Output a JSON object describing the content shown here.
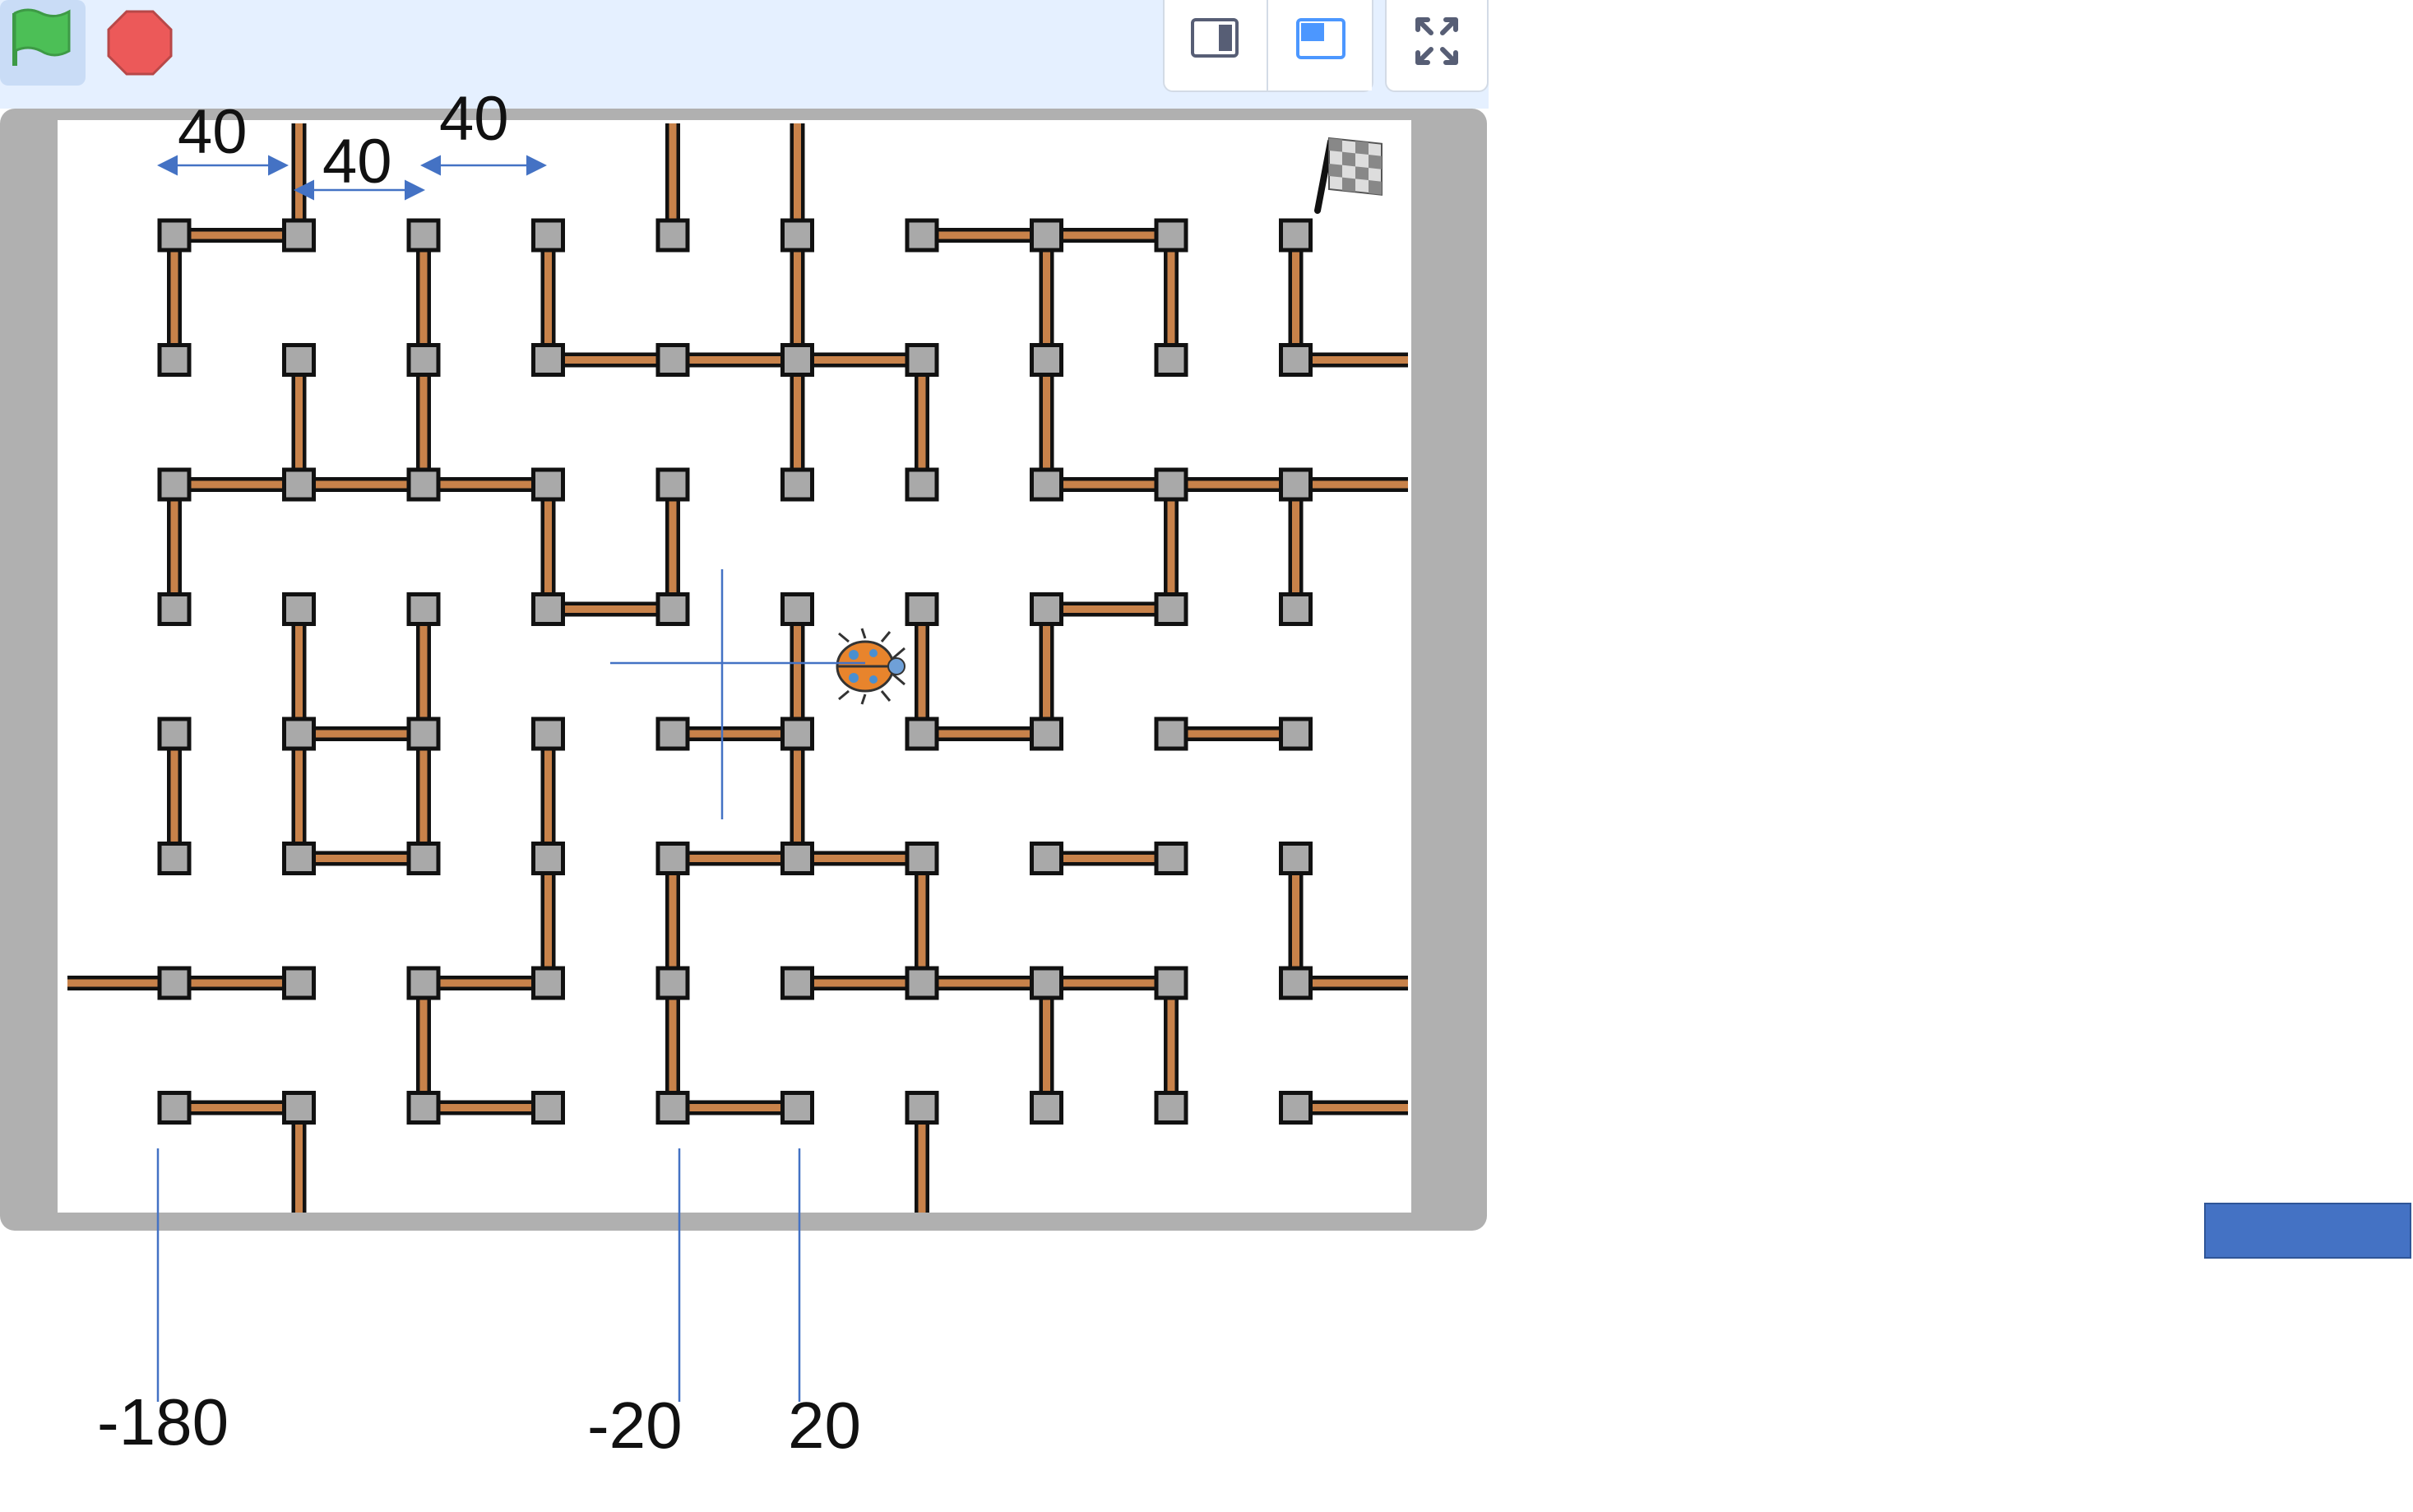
{
  "toolbar": {
    "icons": {
      "green_flag": "green-flag-icon",
      "stop": "stop-icon",
      "small_stage": "small-stage-layout-icon",
      "normal_stage": "normal-stage-layout-icon",
      "fullscreen": "fullscreen-icon"
    },
    "colors": {
      "flag": "#4cbf56",
      "stop": "#ec5959",
      "accent": "#4c97ff"
    }
  },
  "stage": {
    "goal_icon": "checkered-flag-icon",
    "sprite_icon": "ladybug-icon",
    "colors": {
      "wall": "#c8824a",
      "post": "#a9a9a9",
      "frame": "#b0b0b0",
      "background": "#ffffff"
    }
  },
  "annotations": {
    "spacing_labels": [
      "40",
      "40",
      "40"
    ],
    "x_labels": [
      "-180",
      "-20",
      "20"
    ],
    "color": "#4472c4"
  }
}
